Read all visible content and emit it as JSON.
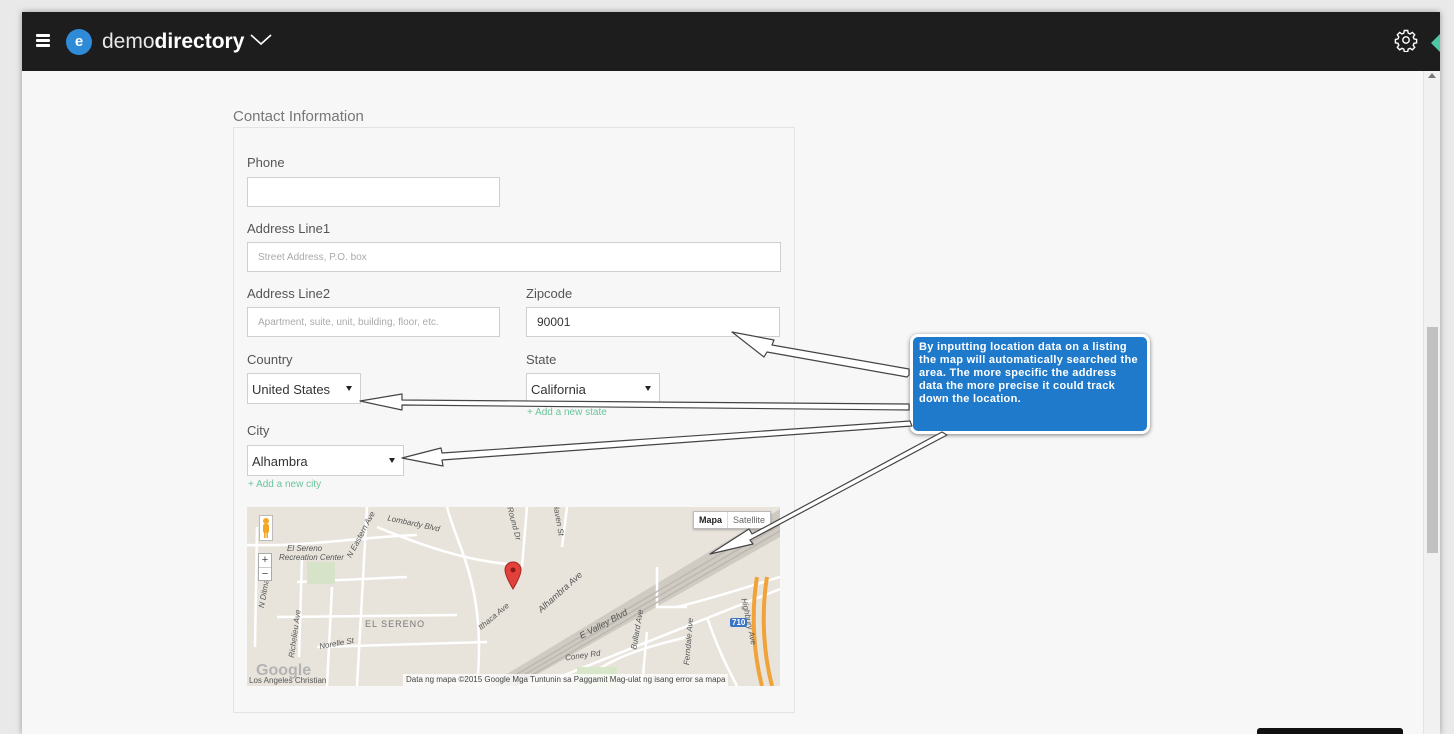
{
  "header": {
    "logo_letter": "e",
    "brand_light": "demo",
    "brand_bold": "directory"
  },
  "contact": {
    "section_title": "Contact Information",
    "phone": {
      "label": "Phone",
      "value": ""
    },
    "address1": {
      "label": "Address Line1",
      "placeholder": "Street Address, P.O. box"
    },
    "address2": {
      "label": "Address Line2",
      "placeholder": "Apartment, suite, unit, building, floor, etc."
    },
    "zipcode": {
      "label": "Zipcode",
      "value": "90001"
    },
    "country": {
      "label": "Country",
      "value": "United States"
    },
    "state": {
      "label": "State",
      "value": "California",
      "add_link": "+ Add a new state"
    },
    "city": {
      "label": "City",
      "value": "Alhambra",
      "add_link": "+ Add a new city"
    }
  },
  "map": {
    "type_buttons": [
      "Mapa",
      "Satellite"
    ],
    "streets": {
      "recreation_line1": "El Sereno",
      "recreation_line2": "Recreation Center",
      "n_eastern": "N Eastern Ave",
      "lombardy": "Lombardy Blvd",
      "round": "Round Dr",
      "haven": "Haven St",
      "alhambra": "Alhambra Ave",
      "ithaca": "Ithaca Ave",
      "e_valley": "E Valley Blvd",
      "bullard": "Bullard Ave",
      "ferndale": "Ferndale Ave",
      "highbury": "Highbury Ave",
      "n_ditman": "N Ditman Ave",
      "richelieu": "Richelieu Ave",
      "norelle": "Norelle St",
      "el_sereno": "EL SERENO",
      "coney": "Coney Rd",
      "la_christian": "Los Angeles Christian",
      "highway": "710"
    },
    "google_logo": "Google",
    "attribution": "Data ng mapa ©2015 Google   Mga Tuntunin sa Paggamit   Mag-ulat ng isang error sa mapa"
  },
  "callout": {
    "text": "By inputting location data on a listing the map will automatically searched the area. The more specific the address data the more precise it could track down the location."
  },
  "colors": {
    "topbar": "#1d1d1d",
    "accent": "#2f8bd8",
    "callout": "#1f7acb",
    "link": "#6bc49b"
  }
}
